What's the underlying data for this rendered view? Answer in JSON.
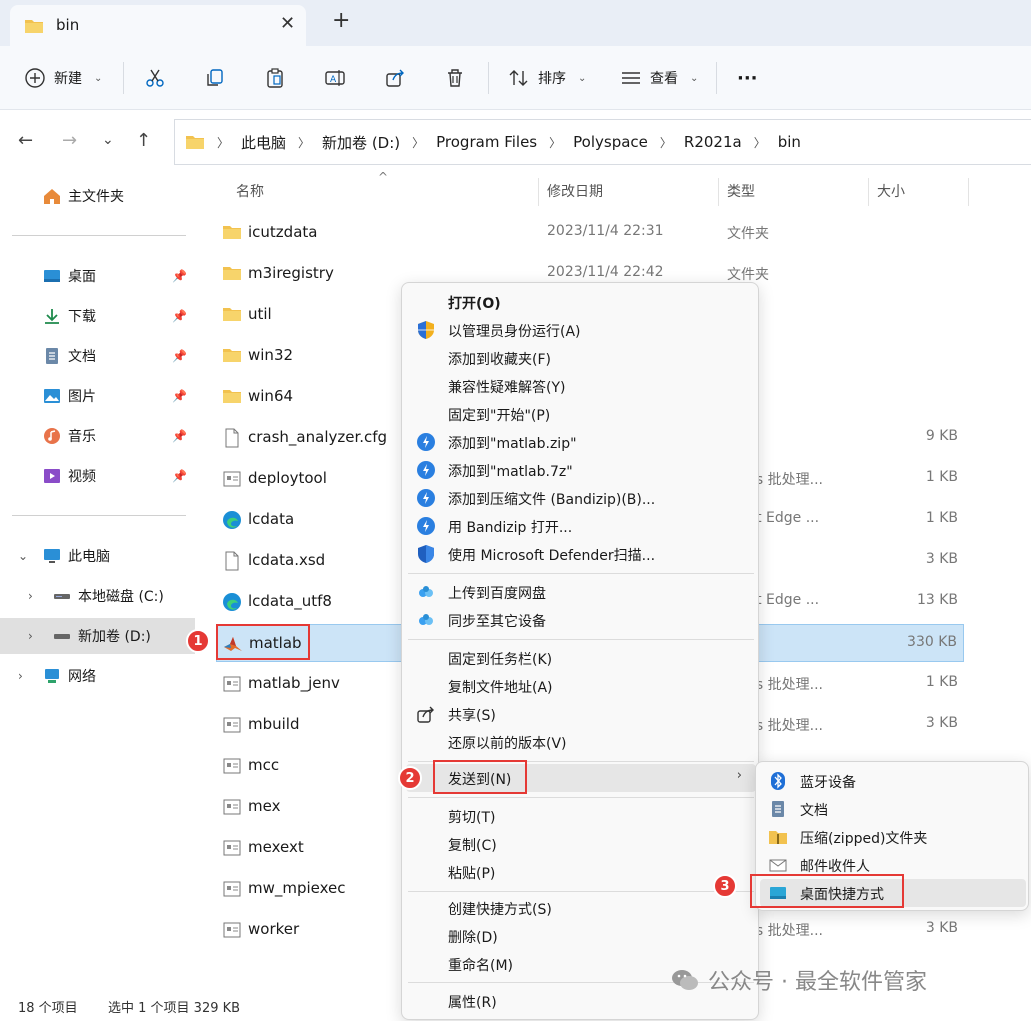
{
  "window": {
    "tab_title": "bin",
    "tab_close": "✕",
    "new_tab": "+"
  },
  "toolbar": {
    "new_label": "新建",
    "sort_label": "排序",
    "view_label": "查看",
    "more_label": "···"
  },
  "address": {
    "crumbs": [
      "此电脑",
      "新加卷 (D:)",
      "Program Files",
      "Polyspace",
      "R2021a",
      "bin"
    ]
  },
  "sidebar": {
    "home": "主文件夹",
    "quick": [
      {
        "label": "桌面"
      },
      {
        "label": "下载"
      },
      {
        "label": "文档"
      },
      {
        "label": "图片"
      },
      {
        "label": "音乐"
      },
      {
        "label": "视频"
      }
    ],
    "this_pc": "此电脑",
    "drive_c": "本地磁盘 (C:)",
    "drive_d": "新加卷 (D:)",
    "network": "网络"
  },
  "columns": {
    "name": "名称",
    "date": "修改日期",
    "type": "类型",
    "size": "大小"
  },
  "files": [
    {
      "name": "icutzdata",
      "date": "2023/11/4 22:31",
      "type": "文件夹",
      "size": ""
    },
    {
      "name": "m3iregistry",
      "date": "2023/11/4 22:42",
      "type": "文件夹",
      "size": ""
    },
    {
      "name": "util",
      "date": "",
      "type": "夹",
      "size": ""
    },
    {
      "name": "win32",
      "date": "",
      "type": "夹",
      "size": ""
    },
    {
      "name": "win64",
      "date": "",
      "type": "夹",
      "size": ""
    },
    {
      "name": "crash_analyzer.cfg",
      "date": "",
      "type": "文件",
      "size": "9 KB"
    },
    {
      "name": "deploytool",
      "date": "",
      "type": "dows 批处理...",
      "size": "1 KB"
    },
    {
      "name": "lcdata",
      "date": "",
      "type": "osoft Edge ...",
      "size": "1 KB"
    },
    {
      "name": "lcdata.xsd",
      "date": "",
      "type": "文件",
      "size": "3 KB"
    },
    {
      "name": "lcdata_utf8",
      "date": "",
      "type": "osoft Edge ...",
      "size": "13 KB"
    },
    {
      "name": "matlab",
      "date": "",
      "type": "程序",
      "size": "330 KB"
    },
    {
      "name": "matlab_jenv",
      "date": "",
      "type": "dows 批处理...",
      "size": "1 KB"
    },
    {
      "name": "mbuild",
      "date": "",
      "type": "dows 批处理...",
      "size": "3 KB"
    },
    {
      "name": "mcc",
      "date": "",
      "type": "",
      "size": ""
    },
    {
      "name": "mex",
      "date": "",
      "type": "",
      "size": ""
    },
    {
      "name": "mexext",
      "date": "",
      "type": "",
      "size": ""
    },
    {
      "name": "mw_mpiexec",
      "date": "",
      "type": "",
      "size": ""
    },
    {
      "name": "worker",
      "date": "",
      "type": "dows 批处理...",
      "size": "3 KB"
    }
  ],
  "status": {
    "count": "18 个项目",
    "selected": "选中 1 个项目  329 KB"
  },
  "context_menu": {
    "items": [
      {
        "label": "打开(O)"
      },
      {
        "label": "以管理员身份运行(A)"
      },
      {
        "label": "添加到收藏夹(F)"
      },
      {
        "label": "兼容性疑难解答(Y)"
      },
      {
        "label": "固定到\"开始\"(P)"
      },
      {
        "label": "添加到\"matlab.zip\""
      },
      {
        "label": "添加到\"matlab.7z\""
      },
      {
        "label": "添加到压缩文件 (Bandizip)(B)..."
      },
      {
        "label": "用 Bandizip 打开..."
      },
      {
        "label": "使用 Microsoft Defender扫描..."
      },
      {
        "label": "上传到百度网盘"
      },
      {
        "label": "同步至其它设备"
      },
      {
        "label": "固定到任务栏(K)"
      },
      {
        "label": "复制文件地址(A)"
      },
      {
        "label": "共享(S)"
      },
      {
        "label": "还原以前的版本(V)"
      },
      {
        "label": "发送到(N)"
      },
      {
        "label": "剪切(T)"
      },
      {
        "label": "复制(C)"
      },
      {
        "label": "粘贴(P)"
      },
      {
        "label": "创建快捷方式(S)"
      },
      {
        "label": "删除(D)"
      },
      {
        "label": "重命名(M)"
      },
      {
        "label": "属性(R)"
      }
    ],
    "arrow": "›"
  },
  "send_to": {
    "items": [
      {
        "label": "蓝牙设备"
      },
      {
        "label": "文档"
      },
      {
        "label": "压缩(zipped)文件夹"
      },
      {
        "label": "邮件收件人"
      },
      {
        "label": "桌面快捷方式"
      }
    ]
  },
  "annotations": {
    "badges": [
      "1",
      "2",
      "3"
    ]
  },
  "watermark": "公众号 · 最全软件管家",
  "colors": {
    "accent": "#0067c0",
    "selection": "#cce4f7",
    "annotation_red": "#e53935",
    "folder": "#f2c24f"
  }
}
